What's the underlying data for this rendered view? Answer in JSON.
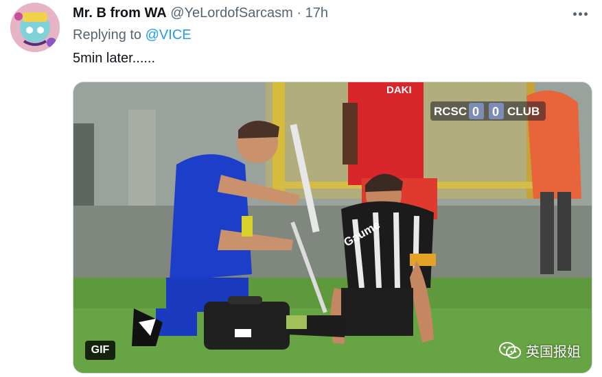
{
  "tweet": {
    "author_name": "Mr. B from WA",
    "author_handle": "@YeLordofSarcasm",
    "separator": "·",
    "time": "17h",
    "reply_prefix": "Replying to",
    "reply_handle": "@VICE",
    "text": "5min later......"
  },
  "media": {
    "scoreboard": {
      "home": "RCSC",
      "home_score": "0",
      "away_score": "0",
      "away": "CLUB"
    },
    "badge": "GIF",
    "watermark": "英国报姐",
    "sponsor_text": "DAKI",
    "shirt_text": "Gaume"
  },
  "colors": {
    "link": "#1d9bf0",
    "secondary_text": "#536471",
    "primary_text": "#0f1419"
  }
}
